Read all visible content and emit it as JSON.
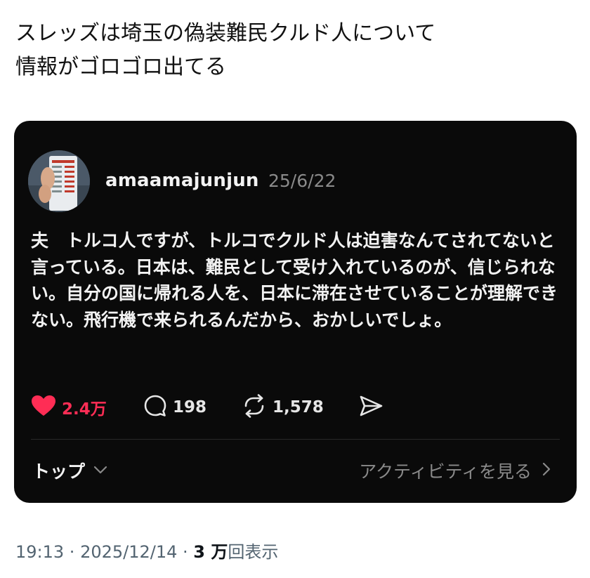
{
  "tweet": {
    "text": "スレッズは埼玉の偽装難民クルド人について\n情報がゴロゴロ出てる"
  },
  "embed": {
    "username": "amaamajunjun",
    "date": "25/6/22",
    "body": "夫　トルコ人ですが、トルコでクルド人は迫害なんてされてないと言っている。日本は、難民として受け入れているのが、信じられない。自分の国に帰れる人を、日本に滞在させていることが理解できない。飛行機で来られるんだから、おかしいでしょ。",
    "actions": {
      "likes": "2.4万",
      "replies": "198",
      "reposts": "1,578"
    },
    "footer": {
      "left_label": "トップ",
      "right_label": "アクティビティを見る"
    },
    "icons": [
      "heart-icon",
      "comment-icon",
      "repost-icon",
      "share-icon",
      "chevron-down-icon",
      "chevron-right-icon"
    ],
    "colors": {
      "like": "#ff2d55",
      "card_bg": "#0a0a0a"
    }
  },
  "meta": {
    "time": "19:13",
    "sep1": " · ",
    "date": "2025/12/14",
    "sep2": " · ",
    "views_count": "3 万",
    "views_label": "回表示"
  }
}
